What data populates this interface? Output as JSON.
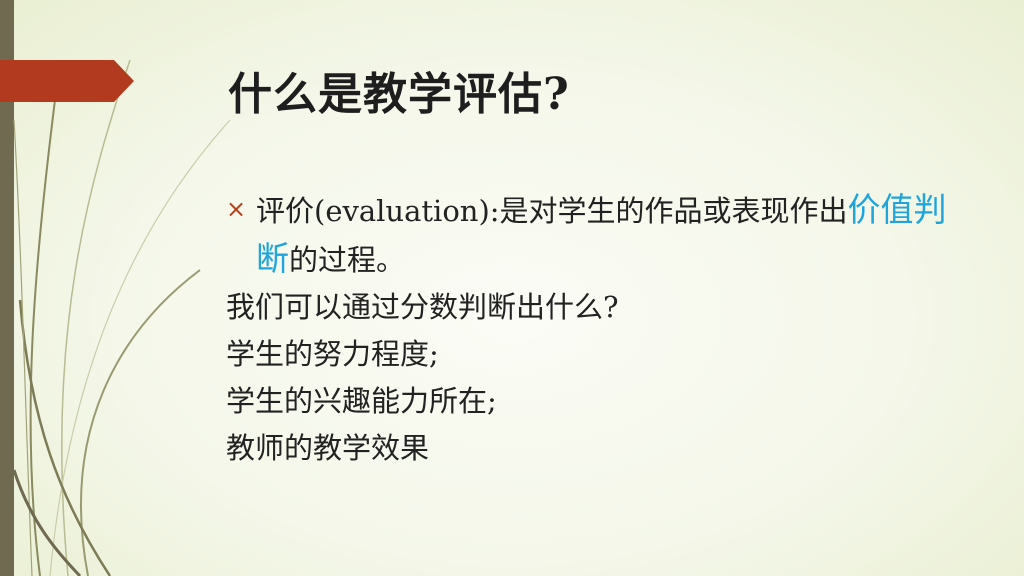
{
  "slide": {
    "title": "什么是教学评估?",
    "bullet": {
      "marker": "×",
      "text_before": "评价(evaluation):是对学生的作品或表现作出",
      "highlight": "价值判断",
      "text_after": "的过程。"
    },
    "lines": [
      "我们可以通过分数判断出什么?",
      "学生的努力程度;",
      "学生的兴趣能力所在;",
      "教师的教学效果"
    ],
    "colors": {
      "accent_arrow": "#b23a1e",
      "bullet": "#b4401e",
      "highlight": "#1fa4dc",
      "left_bar": "#6f6a50"
    }
  }
}
